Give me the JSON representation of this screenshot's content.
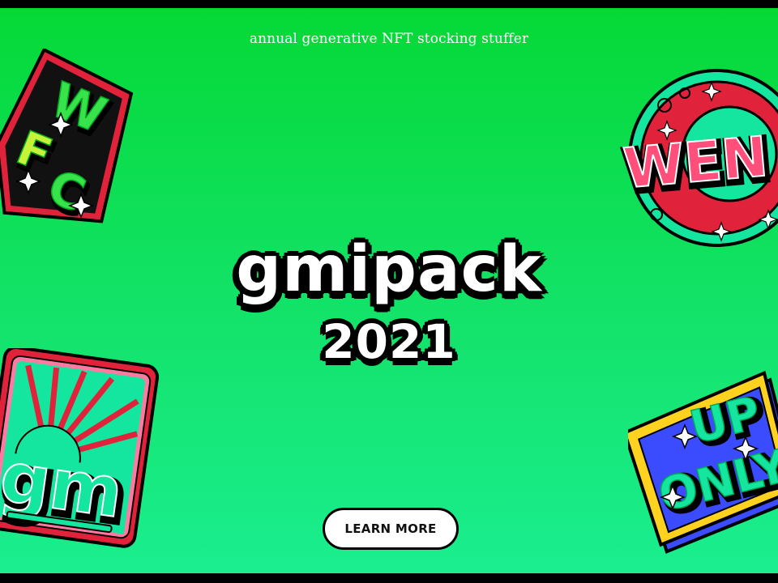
{
  "header": {
    "tagline": "annual generative NFT stocking stuffer"
  },
  "logo": {
    "line1": "gmipack",
    "line2": "2021"
  },
  "cta": {
    "label": "LEARN MORE"
  },
  "stickers": {
    "wagmi": {
      "text": "WFC"
    },
    "wen": {
      "text": "WEN"
    },
    "gm": {
      "text": "gm"
    },
    "up_only": {
      "line1": "UP",
      "line2": "ONLY"
    }
  },
  "colors": {
    "background_top": "#05d936",
    "background_bottom": "#1aee8f",
    "sticker_red": "#e0223a",
    "sticker_teal": "#14e6a0",
    "sticker_yellow": "#ffd21f",
    "outline": "#000000"
  }
}
